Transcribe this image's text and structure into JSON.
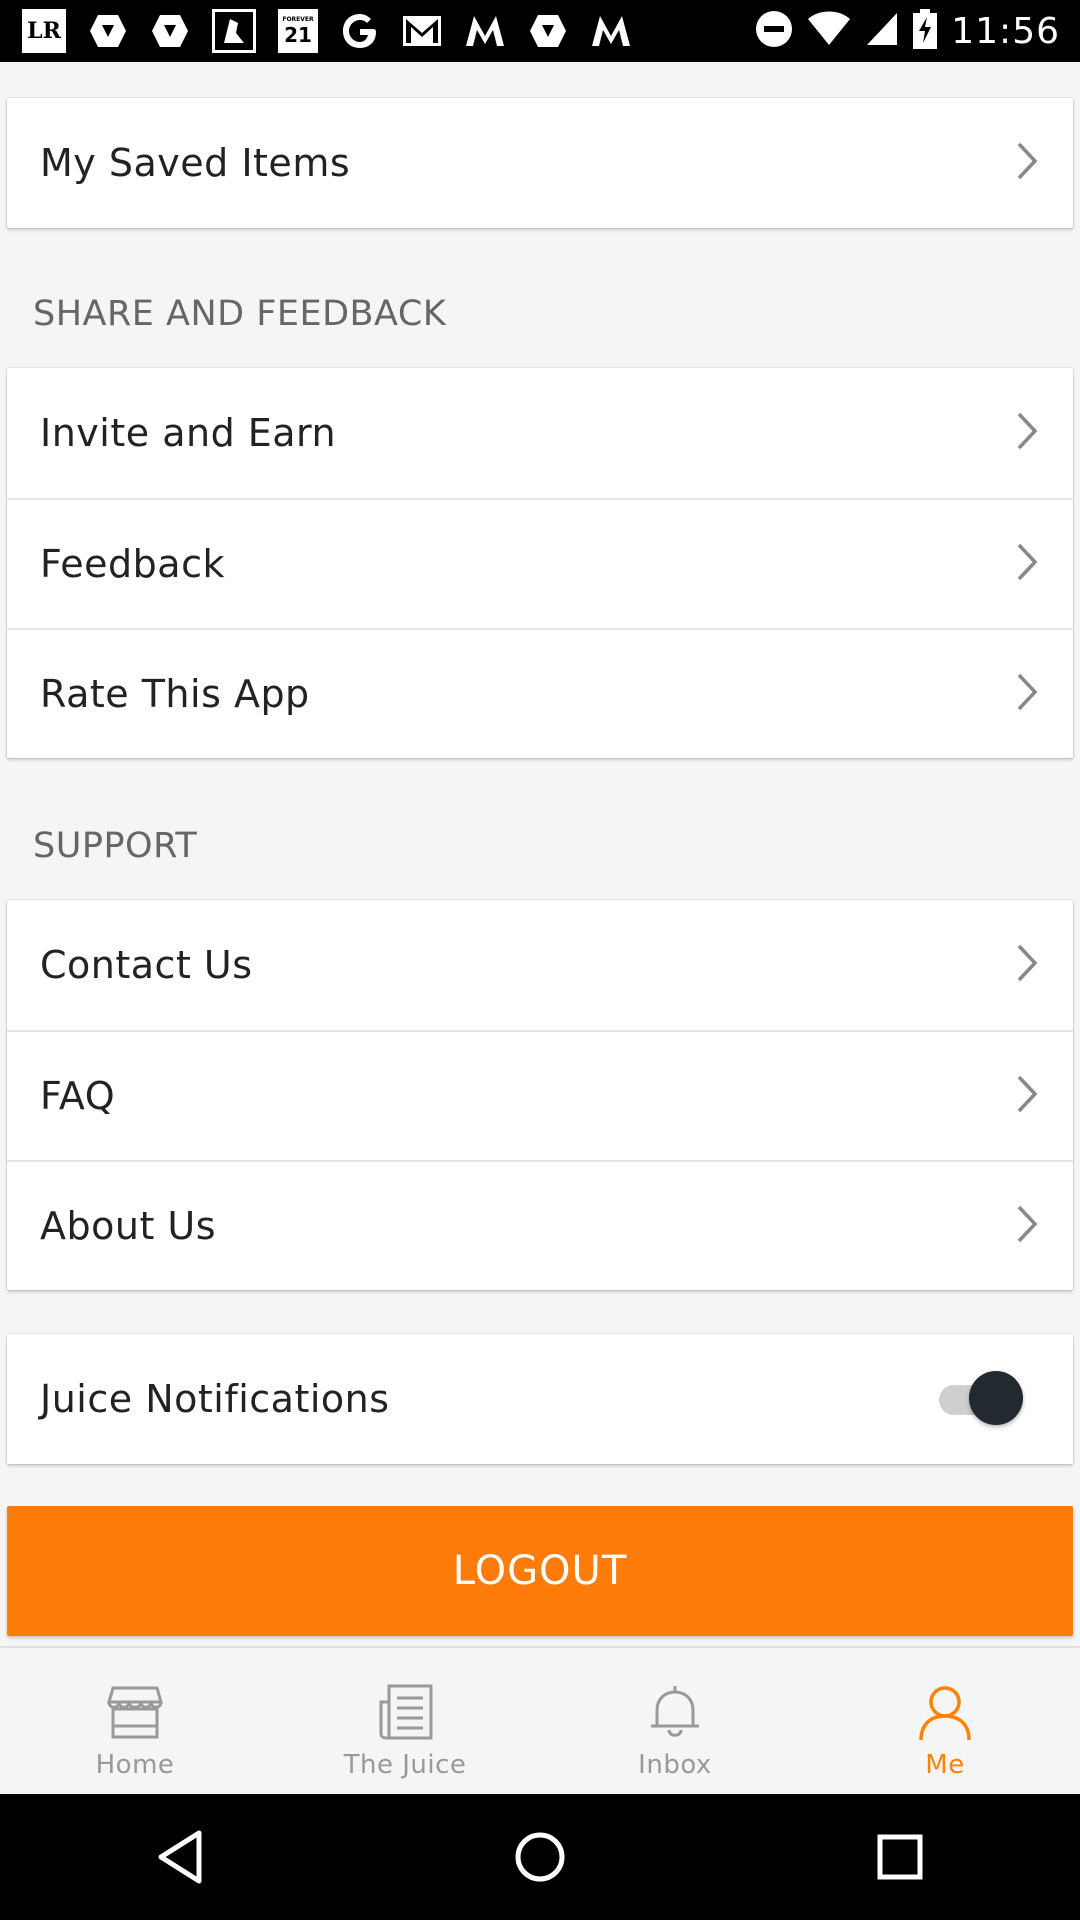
{
  "status_bar": {
    "time": "11:56",
    "lr_label": "LR",
    "f21_small": "FOREVER",
    "f21_big": "21",
    "icons": [
      "lr-app-icon",
      "app-icon",
      "app-icon",
      "app-icon",
      "forever21-icon",
      "google-icon",
      "gmail-icon",
      "m-icon",
      "app-icon",
      "m-icon",
      "dnd-icon",
      "wifi-icon",
      "signal-icon",
      "battery-icon"
    ]
  },
  "saved": {
    "label": "My Saved Items"
  },
  "share_feedback": {
    "title": "SHARE AND FEEDBACK",
    "items": [
      {
        "label": "Invite and Earn"
      },
      {
        "label": "Feedback"
      },
      {
        "label": "Rate This App"
      }
    ]
  },
  "support": {
    "title": "SUPPORT",
    "items": [
      {
        "label": "Contact Us"
      },
      {
        "label": "FAQ"
      },
      {
        "label": "About Us"
      }
    ]
  },
  "notifications": {
    "label": "Juice Notifications",
    "enabled": true
  },
  "logout": {
    "label": "LOGOUT"
  },
  "bottom_nav": {
    "items": [
      {
        "label": "Home",
        "icon": "store-icon",
        "active": false
      },
      {
        "label": "The Juice",
        "icon": "news-icon",
        "active": false
      },
      {
        "label": "Inbox",
        "icon": "bell-icon",
        "active": false
      },
      {
        "label": "Me",
        "icon": "person-icon",
        "active": true
      }
    ]
  },
  "colors": {
    "accent": "#ff7b0a",
    "inactive": "#999999",
    "toggle_knob": "#222a30"
  }
}
